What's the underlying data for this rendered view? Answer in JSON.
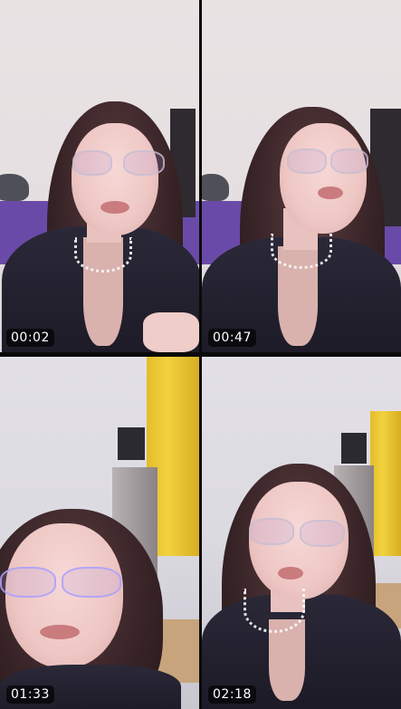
{
  "grid": {
    "tiles": [
      {
        "timestamp": "00:02"
      },
      {
        "timestamp": "00:47"
      },
      {
        "timestamp": "01:33"
      },
      {
        "timestamp": "02:18"
      }
    ]
  }
}
